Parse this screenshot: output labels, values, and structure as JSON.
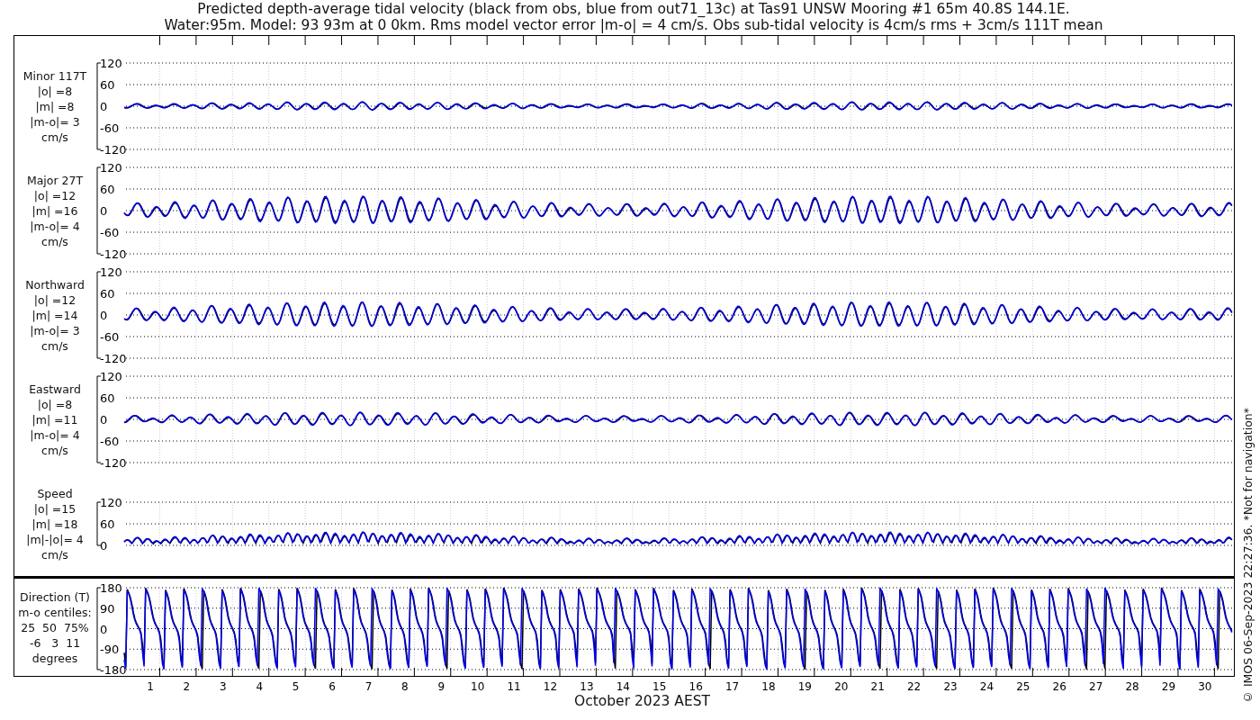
{
  "title": [
    "Predicted depth-average tidal velocity (black from obs, blue from out71_13c) at Tas91 UNSW Mooring #1 65m 40.8S 144.1E.",
    "Water:95m. Model: 93 93m at 0 0km. Rms model vector error |m-o| = 4 cm/s. Obs sub-tidal velocity is 4cm/s rms + 3cm/s 111T mean"
  ],
  "panels": [
    {
      "kind": "velocity",
      "label": [
        "Minor 117T",
        "|o| =8",
        "|m| =8",
        "|m-o|= 3",
        "cm/s"
      ],
      "yticks": [
        "120",
        "60",
        "0",
        "-60",
        "-120"
      ]
    },
    {
      "kind": "velocity",
      "label": [
        "Major 27T",
        "|o| =12",
        "|m| =16",
        "|m-o|= 4",
        "cm/s"
      ],
      "yticks": [
        "120",
        "60",
        "0",
        "-60",
        "-120"
      ]
    },
    {
      "kind": "velocity",
      "label": [
        "Northward",
        "|o| =12",
        "|m| =14",
        "|m-o|= 3",
        "cm/s"
      ],
      "yticks": [
        "120",
        "60",
        "0",
        "-60",
        "-120"
      ]
    },
    {
      "kind": "velocity",
      "label": [
        "Eastward",
        "|o| =8",
        "|m| =11",
        "|m-o|= 4",
        "cm/s"
      ],
      "yticks": [
        "120",
        "60",
        "0",
        "-60",
        "-120"
      ]
    },
    {
      "kind": "speed",
      "label": [
        "Speed",
        "|o| =15",
        "|m| =18",
        "|m|-|o|= 4",
        "cm/s"
      ],
      "yticks": [
        "120",
        "60",
        "0"
      ]
    },
    {
      "kind": "direction",
      "label": [
        "Direction (T)",
        "m-o centiles:",
        "25  50  75%",
        "-6   3  11",
        "degrees"
      ],
      "yticks": [
        "180",
        "90",
        "0",
        "-90",
        "-180"
      ]
    }
  ],
  "xticks": [
    "1",
    "2",
    "3",
    "4",
    "5",
    "6",
    "7",
    "8",
    "9",
    "10",
    "11",
    "12",
    "13",
    "14",
    "15",
    "16",
    "17",
    "18",
    "19",
    "20",
    "21",
    "22",
    "23",
    "24",
    "25",
    "26",
    "27",
    "28",
    "29",
    "30"
  ],
  "xlabel": "October 2023 AEST",
  "footer": "© IMOS 06-Sep-2023 22:27:36. *Not for navigation*"
}
